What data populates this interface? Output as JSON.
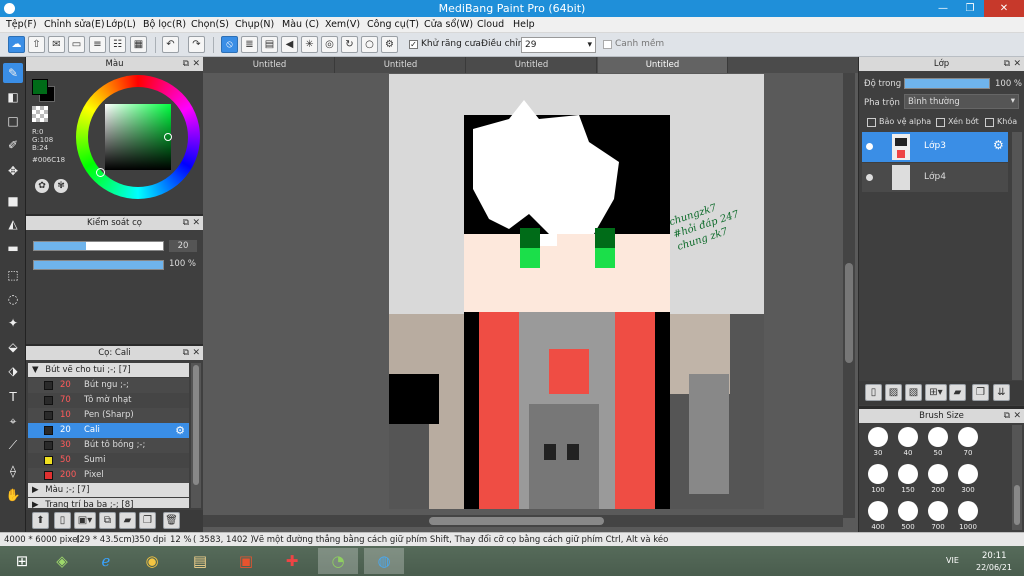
{
  "window": {
    "title": "MediBang Paint Pro (64bit)",
    "minimize": "—",
    "restore": "❐",
    "close": "✕"
  },
  "menu": [
    "Tệp(F)",
    "Chỉnh sửa(E)",
    "Lớp(L)",
    "Bộ lọc(R)",
    "Chọn(S)",
    "Chụp(N)",
    "Màu (C)",
    "Xem(V)",
    "Công cụ(T)",
    "Cửa sổ(W)",
    "Cloud",
    "Help"
  ],
  "toolbar": {
    "antialias_label": "Khử răng cưa",
    "antialias_checked": true,
    "correction_label": "Điều chỉnh",
    "correction_value": "29",
    "edge_label": "Canh mềm",
    "edge_checked": false
  },
  "color_panel": {
    "title": "Màu",
    "r": "R:0",
    "g": "G:108",
    "b": "B:24",
    "hex": "#006C18",
    "current_color": "#006c18"
  },
  "brush_control": {
    "title": "Kiểm soát cọ",
    "size_value": "20",
    "size_fraction": 0.4,
    "opacity_value": "100 %",
    "opacity_fraction": 1.0
  },
  "brush_panel": {
    "title": "Cọ: Cali",
    "group_open": "Bút vẽ cho tui ;-; [7]",
    "brushes": [
      {
        "size": "20",
        "name": "Bút ngu ;-;",
        "color": "#2a2a2a",
        "selected": false
      },
      {
        "size": "70",
        "name": "Tô mờ nhạt",
        "color": "#2a2a2a",
        "selected": false
      },
      {
        "size": "10",
        "name": "Pen (Sharp)",
        "color": "#2a2a2a",
        "selected": false
      },
      {
        "size": "20",
        "name": "Cali",
        "color": "#2a2a2a",
        "selected": true
      },
      {
        "size": "30",
        "name": "Bút tô bóng ;-;",
        "color": "#2a2a2a",
        "selected": false
      },
      {
        "size": "50",
        "name": "Sumi",
        "color": "#f0e020",
        "selected": false
      },
      {
        "size": "200",
        "name": "Pixel",
        "color": "#e03030",
        "selected": false
      }
    ],
    "group2": "Màu ;-; [7]",
    "group3": "Trang trí ba ba ;-; [8]"
  },
  "tabs": [
    "Untitled",
    "Untitled",
    "Untitled",
    "Untitled"
  ],
  "signature": "chungzk7 #hỏi đáp 247 chung zk7",
  "layer_panel": {
    "title": "Lớp",
    "opacity_label": "Độ trong",
    "opacity_value": "100 %",
    "opacity_fraction": 1.0,
    "blend_label": "Pha trộn",
    "blend_value": "Bình thường",
    "protect_alpha": "Bảo vệ alpha",
    "clipping": "Xén bớt",
    "lock": "Khóa",
    "layers": [
      {
        "name": "Lớp3",
        "selected": true
      },
      {
        "name": "Lớp4",
        "selected": false
      }
    ]
  },
  "brush_size_panel": {
    "title": "Brush Size",
    "sizes": [
      "30",
      "40",
      "50",
      "70",
      "100",
      "150",
      "200",
      "300",
      "400",
      "500",
      "700",
      "1000"
    ]
  },
  "status": {
    "dimensions": "4000 * 6000 pixel",
    "physical": "(29 * 43.5cm)",
    "dpi": "350 dpi",
    "zoom": "12 %",
    "coords": "( 3583, 1402 )",
    "hint": "Vẽ một đường thẳng bằng cách giữ phím Shift, Thay đổi cỡ cọ bằng cách giữ phím Ctrl, Alt và kéo"
  },
  "taskbar": {
    "lang": "VIE",
    "time": "20:11",
    "date": "22/06/21"
  },
  "colors": {
    "accent": "#3a8ee6",
    "titlebar": "#1f8fd9"
  }
}
